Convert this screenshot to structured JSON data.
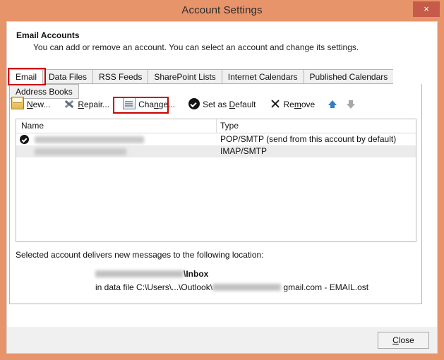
{
  "window": {
    "title": "Account Settings",
    "close_icon": "close-x-icon",
    "close_glyph": "×",
    "titlebar_color": "#e8946a",
    "close_button_color": "#c75b4a",
    "highlight_color": "#cc0000"
  },
  "header": {
    "title": "Email Accounts",
    "subtitle": "You can add or remove an account. You can select an account and change its settings."
  },
  "tabs": [
    {
      "label": "Email",
      "active": true,
      "highlighted": true
    },
    {
      "label": "Data Files",
      "active": false,
      "highlighted": false
    },
    {
      "label": "RSS Feeds",
      "active": false,
      "highlighted": false
    },
    {
      "label": "SharePoint Lists",
      "active": false,
      "highlighted": false
    },
    {
      "label": "Internet Calendars",
      "active": false,
      "highlighted": false
    },
    {
      "label": "Published Calendars",
      "active": false,
      "highlighted": false
    },
    {
      "label": "Address Books",
      "active": false,
      "highlighted": false
    }
  ],
  "toolbar": {
    "buttons": [
      {
        "name": "new-button",
        "icon": "new-mail-icon",
        "pre": "",
        "accel": "N",
        "post": "ew...",
        "disabled": false,
        "highlighted": false
      },
      {
        "name": "repair-button",
        "icon": "repair-tools-icon",
        "pre": "",
        "accel": "R",
        "post": "epair...",
        "disabled": false,
        "highlighted": false
      },
      {
        "name": "change-button",
        "icon": "change-account-icon",
        "pre": "Cha",
        "accel": "n",
        "post": "ge...",
        "disabled": false,
        "highlighted": true
      },
      {
        "name": "set-as-default-button",
        "icon": "check-circle-icon",
        "pre": "Set as ",
        "accel": "D",
        "post": "efault",
        "disabled": false,
        "highlighted": false
      },
      {
        "name": "remove-button",
        "icon": "remove-x-icon",
        "pre": "Re",
        "accel": "m",
        "post": "ove",
        "disabled": false,
        "highlighted": false
      }
    ],
    "move_up": {
      "name": "move-up-button",
      "icon": "arrow-up-icon",
      "enabled": true,
      "color": "#2f7fc4"
    },
    "move_down": {
      "name": "move-down-button",
      "icon": "arrow-down-icon",
      "enabled": false,
      "color": "#a8a8a8"
    }
  },
  "accounts_list": {
    "columns": [
      "Name",
      "Type"
    ],
    "rows": [
      {
        "name_redacted": true,
        "name_width": 155,
        "type": "POP/SMTP (send from this account by default)",
        "is_default": true,
        "selected": false
      },
      {
        "name_redacted": true,
        "name_width": 130,
        "type": "IMAP/SMTP",
        "is_default": false,
        "selected": true
      }
    ]
  },
  "location": {
    "label": "Selected account delivers new messages to the following location:",
    "line1_redacted_width": 125,
    "line1_text": "\\Inbox",
    "line2_prefix": "in data file C:\\Users\\...\\Outlook\\",
    "line2_redacted_width": 97,
    "line2_suffix": " gmail.com - EMAIL.ost"
  },
  "footer": {
    "close": {
      "pre": "",
      "accel": "C",
      "post": "lose"
    }
  }
}
